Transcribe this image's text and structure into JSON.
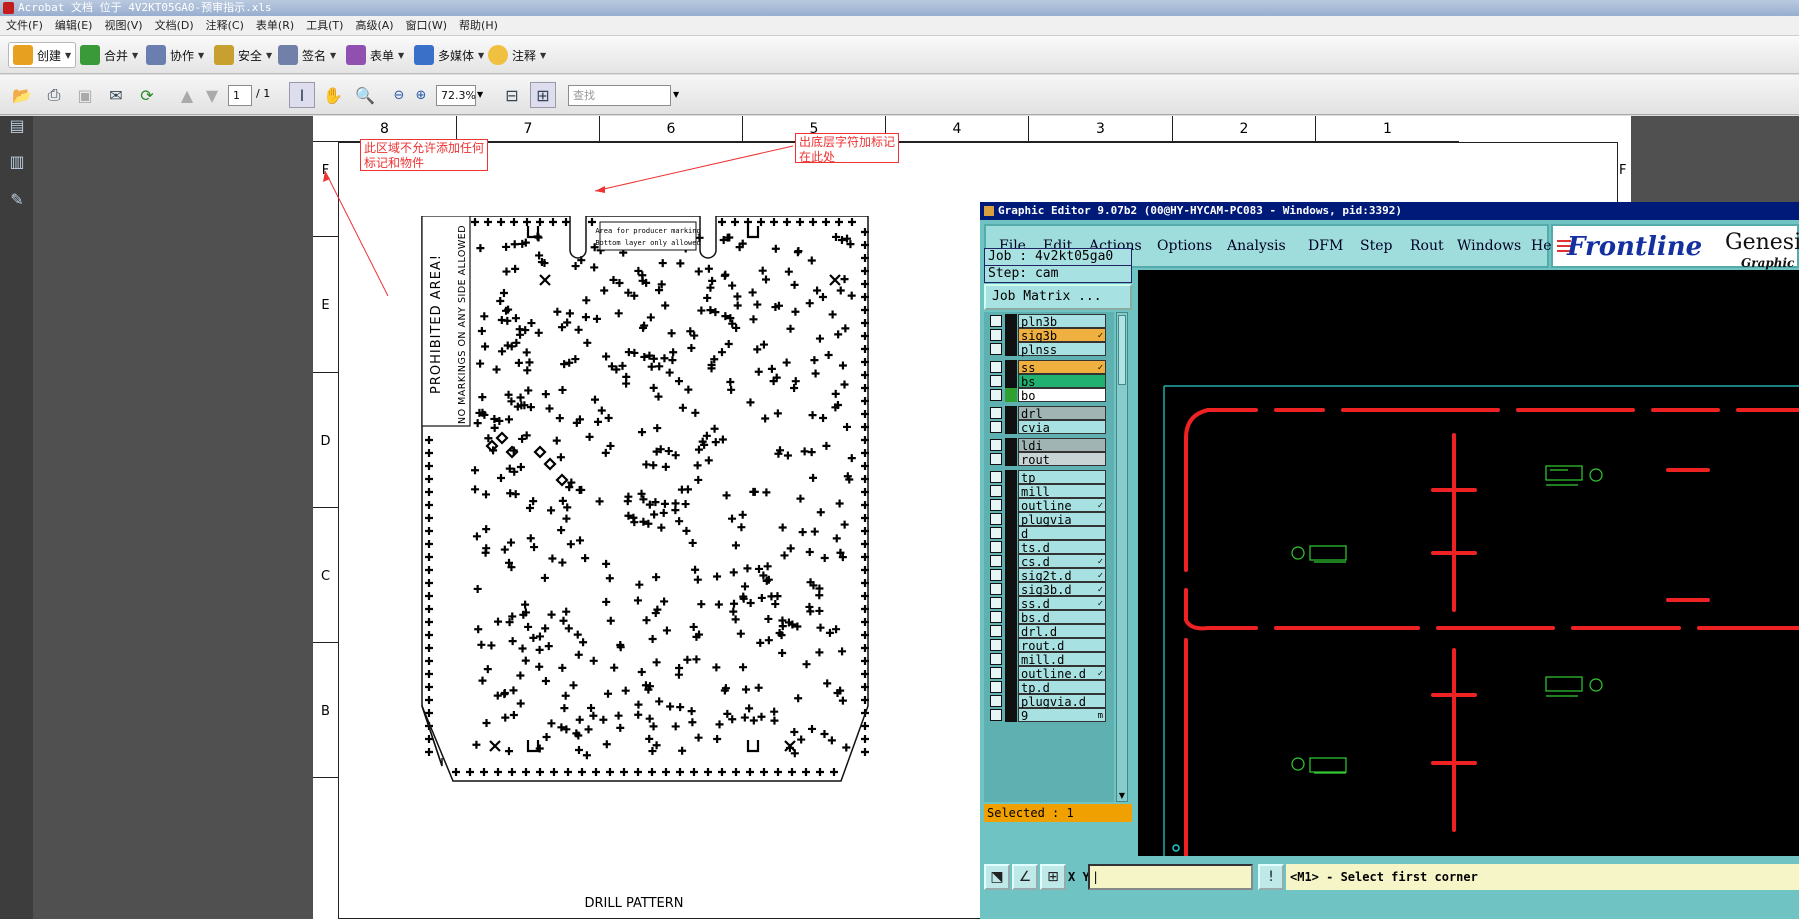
{
  "window": {
    "title": "Acrobat 文档 位于 4V2KT05GA0-预审指示.xls"
  },
  "menu": [
    "文件(F)",
    "编辑(E)",
    "视图(V)",
    "文档(D)",
    "注释(C)",
    "表单(R)",
    "工具(T)",
    "高级(A)",
    "窗口(W)",
    "帮助(H)"
  ],
  "tasks": {
    "create": "创建",
    "combine": "合并",
    "collaborate": "协作",
    "secure": "安全",
    "sign": "签名",
    "forms": "表单",
    "multimedia": "多媒体",
    "comment": "注释"
  },
  "nav": {
    "page": "1",
    "page_total": "/ 1",
    "zoom": "72.3%",
    "find_placeholder": "查找"
  },
  "drawing": {
    "columns": [
      "8",
      "7",
      "6",
      "5",
      "4",
      "3",
      "2",
      "1"
    ],
    "rows": [
      "F",
      "E",
      "D",
      "C",
      "B"
    ],
    "right_row": "F",
    "note1": "此区域不允许添加任何标记和物件",
    "note2": "出底层字符加标记在此处",
    "prohibited": "PROHIBITED AREA!",
    "no_markings": "NO MARKINGS ON ANY SIDE ALLOWED",
    "area_line1": "Area for producer marking",
    "area_line2": "Bottom layer only allowed",
    "caption": "DRILL PATTERN"
  },
  "genesis": {
    "title": "Graphic Editor 9.07b2 (00@HY-HYCAM-PC083 - Windows, pid:3392)",
    "menu": [
      "File",
      "Edit",
      "Actions",
      "Options",
      "Analysis",
      "DFM",
      "Step",
      "Rout",
      "Windows",
      "Help"
    ],
    "logo": "Frontline",
    "logo_right": "Genesi",
    "logo_sub": "Graphic",
    "job": "Job : 4v2kt05ga0",
    "step": "Step: cam",
    "job_matrix": "Job Matrix ...",
    "layers": [
      {
        "name": "pln3b",
        "color": "#a8e1e1"
      },
      {
        "name": "sig3b",
        "color": "#f0b040",
        "mark": "✓"
      },
      {
        "name": "plnss",
        "color": "#a8e1e1"
      },
      {
        "name": "ss",
        "color": "#f0b040",
        "mark": "✓"
      },
      {
        "name": "bs",
        "color": "#20b070"
      },
      {
        "name": "bo",
        "color": "#ffffff",
        "sw": "#30a030"
      },
      {
        "name": "drl",
        "color": "#a0b4b4"
      },
      {
        "name": "cvia",
        "color": "#a8e1e1"
      },
      {
        "name": "ldi",
        "color": "#a0b4b4"
      },
      {
        "name": "rout",
        "color": "#c8d4d4"
      },
      {
        "name": "tp",
        "color": "#a8e1e1"
      },
      {
        "name": "mill",
        "color": "#a8e1e1"
      },
      {
        "name": "outline",
        "color": "#a8e1e1",
        "mark": "✓"
      },
      {
        "name": "plugvia",
        "color": "#a8e1e1"
      },
      {
        "name": "d",
        "color": "#a8e1e1"
      },
      {
        "name": "ts.d",
        "color": "#a8e1e1"
      },
      {
        "name": "cs.d",
        "color": "#a8e1e1",
        "mark": "✓"
      },
      {
        "name": "sig2t.d",
        "color": "#a8e1e1",
        "mark": "✓"
      },
      {
        "name": "sig3b.d",
        "color": "#a8e1e1",
        "mark": "✓"
      },
      {
        "name": "ss.d",
        "color": "#a8e1e1",
        "mark": "✓"
      },
      {
        "name": "bs.d",
        "color": "#a8e1e1"
      },
      {
        "name": "drl.d",
        "color": "#a8e1e1"
      },
      {
        "name": "rout.d",
        "color": "#a8e1e1"
      },
      {
        "name": "mill.d",
        "color": "#a8e1e1"
      },
      {
        "name": "outline.d",
        "color": "#a8e1e1",
        "mark": "✓"
      },
      {
        "name": "tp.d",
        "color": "#a8e1e1"
      },
      {
        "name": "plugvia.d",
        "color": "#a8e1e1"
      },
      {
        "name": "9",
        "color": "#a8e1e1",
        "mark": "m"
      }
    ],
    "selected": "Selected : 1",
    "xy_label": "X Y :",
    "status": "<M1> - Select first corner"
  }
}
